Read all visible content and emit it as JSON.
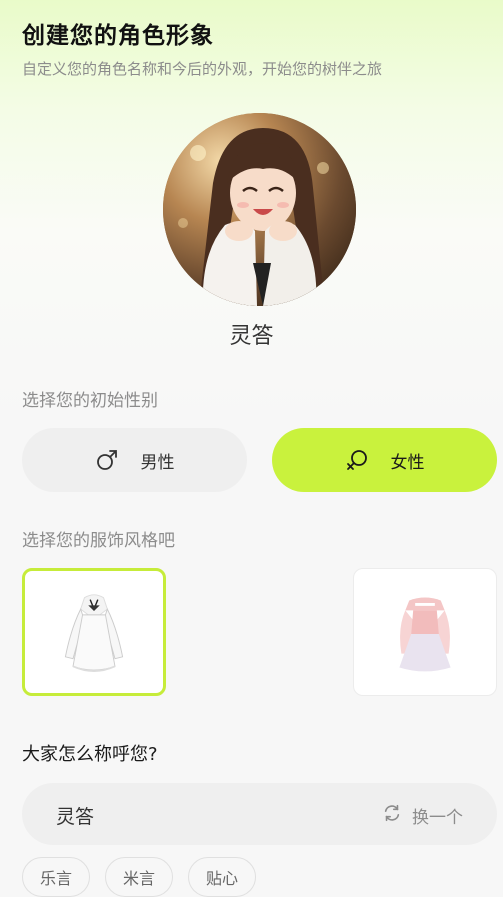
{
  "header": {
    "title": "创建您的角色形象",
    "subtitle": "自定义您的角色名称和今后的外观，开始您的树伴之旅"
  },
  "avatar": {
    "name": "灵答"
  },
  "gender": {
    "label": "选择您的初始性别",
    "options": [
      {
        "label": "男性",
        "icon": "male-icon",
        "selected": false
      },
      {
        "label": "女性",
        "icon": "female-icon",
        "selected": true
      }
    ]
  },
  "outfit": {
    "label": "选择您的服饰风格吧",
    "options": [
      {
        "name": "white-dress",
        "selected": true
      },
      {
        "name": "pink-dress",
        "selected": false
      }
    ]
  },
  "naming": {
    "question": "大家怎么称呼您?",
    "value": "灵答",
    "change_label": "换一个",
    "suggestions": [
      "乐言",
      "米言",
      "贴心"
    ]
  },
  "colors": {
    "accent": "#c9f23d",
    "accent_border": "#c6ec3a"
  }
}
